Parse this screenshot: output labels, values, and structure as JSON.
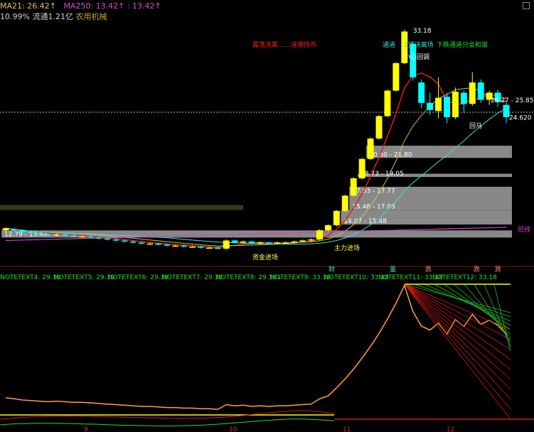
{
  "header": {
    "ma21_label": "MA21: 26.42↑",
    "ma250_label": "MA250: 13.42↑",
    "ma250_value": ": 13.42↑",
    "turnover": "10.99%",
    "float_cap": "流通1.21亿",
    "sector": "农用机械"
  },
  "colors": {
    "up": "#ffff00",
    "down": "#00ffff",
    "ma_red": "#e02020",
    "ma_olive": "#c8c050",
    "ma_magenta": "#d040d0",
    "ma_cyan": "#40e0d0",
    "note_green": "#20e020",
    "gap_gray": "#a0a0a0"
  },
  "chart_data": {
    "type": "candlestick",
    "x_ticks": [
      "9",
      "10",
      "11",
      "12"
    ],
    "price_labels": {
      "high": "33.18",
      "current": "24.620",
      "range_top": "26.27 - 25.85"
    },
    "gap_zones": [
      {
        "label": "20.60 - 21.80",
        "low": 20.6,
        "high": 21.8
      },
      {
        "label": "18.73 - 19.05",
        "low": 18.73,
        "high": 19.05
      },
      {
        "label": "17.03 - 17.77",
        "low": 17.03,
        "high": 17.77
      },
      {
        "label": "15.48 - 17.03",
        "low": 15.48,
        "high": 17.03
      },
      {
        "label": "14.07 - 15.48",
        "low": 14.07,
        "high": 15.48
      },
      {
        "label": "12.79 - 13.49",
        "low": 12.79,
        "high": 13.49
      }
    ],
    "annotations": {
      "wash": "震荡洗筹……道德持币",
      "tongdao_top": "通道",
      "tongdao_top_tail": "2坚决离场",
      "careful": "小心回调",
      "down_tongdao": "下跌通道只会和谐",
      "main_in": "资金进场",
      "main_in2": "主力进场",
      "pullback": "回马",
      "low_line": "低线",
      "huima": "回马"
    },
    "candles": [
      {
        "o": 13.5,
        "c": 13.7,
        "h": 13.8,
        "l": 13.4
      },
      {
        "o": 13.6,
        "c": 13.5,
        "h": 13.7,
        "l": 13.4
      },
      {
        "o": 13.5,
        "c": 13.3,
        "h": 13.6,
        "l": 13.2
      },
      {
        "o": 13.3,
        "c": 13.2,
        "h": 13.4,
        "l": 13.1
      },
      {
        "o": 13.2,
        "c": 13.1,
        "h": 13.3,
        "l": 13.0
      },
      {
        "o": 13.1,
        "c": 13.0,
        "h": 13.2,
        "l": 12.9
      },
      {
        "o": 13.0,
        "c": 13.1,
        "h": 13.2,
        "l": 12.9
      },
      {
        "o": 13.1,
        "c": 13.0,
        "h": 13.2,
        "l": 12.9
      },
      {
        "o": 13.0,
        "c": 12.9,
        "h": 13.1,
        "l": 12.8
      },
      {
        "o": 12.9,
        "c": 12.9,
        "h": 13.0,
        "l": 12.8
      },
      {
        "o": 12.9,
        "c": 12.8,
        "h": 13.0,
        "l": 12.7
      },
      {
        "o": 12.8,
        "c": 12.7,
        "h": 12.9,
        "l": 12.6
      },
      {
        "o": 12.7,
        "c": 12.6,
        "h": 12.8,
        "l": 12.5
      },
      {
        "o": 12.6,
        "c": 12.5,
        "h": 12.7,
        "l": 12.4
      },
      {
        "o": 12.5,
        "c": 12.4,
        "h": 12.6,
        "l": 12.3
      },
      {
        "o": 12.4,
        "c": 12.3,
        "h": 12.5,
        "l": 12.2
      },
      {
        "o": 12.3,
        "c": 12.2,
        "h": 12.4,
        "l": 12.1
      },
      {
        "o": 12.2,
        "c": 12.2,
        "h": 12.3,
        "l": 12.1
      },
      {
        "o": 12.2,
        "c": 12.1,
        "h": 12.3,
        "l": 12.0
      },
      {
        "o": 12.1,
        "c": 12.0,
        "h": 12.2,
        "l": 11.9
      },
      {
        "o": 12.0,
        "c": 12.0,
        "h": 12.1,
        "l": 11.9
      },
      {
        "o": 12.0,
        "c": 11.9,
        "h": 12.1,
        "l": 11.8
      },
      {
        "o": 11.9,
        "c": 11.9,
        "h": 12.0,
        "l": 11.8
      },
      {
        "o": 11.9,
        "c": 11.8,
        "h": 12.0,
        "l": 11.7
      },
      {
        "o": 11.8,
        "c": 11.8,
        "h": 11.9,
        "l": 11.7
      },
      {
        "o": 11.8,
        "c": 11.7,
        "h": 11.9,
        "l": 11.6
      },
      {
        "o": 11.7,
        "c": 12.5,
        "h": 12.6,
        "l": 11.6
      },
      {
        "o": 12.5,
        "c": 12.3,
        "h": 12.6,
        "l": 12.2
      },
      {
        "o": 12.3,
        "c": 12.4,
        "h": 12.5,
        "l": 12.2
      },
      {
        "o": 12.4,
        "c": 12.2,
        "h": 12.5,
        "l": 12.1
      },
      {
        "o": 12.2,
        "c": 12.3,
        "h": 12.4,
        "l": 12.1
      },
      {
        "o": 12.3,
        "c": 12.2,
        "h": 12.4,
        "l": 12.1
      },
      {
        "o": 12.2,
        "c": 12.3,
        "h": 12.4,
        "l": 12.1
      },
      {
        "o": 12.3,
        "c": 12.3,
        "h": 12.4,
        "l": 12.2
      },
      {
        "o": 12.3,
        "c": 12.4,
        "h": 12.5,
        "l": 12.2
      },
      {
        "o": 12.4,
        "c": 12.5,
        "h": 12.6,
        "l": 12.3
      },
      {
        "o": 12.5,
        "c": 12.6,
        "h": 12.7,
        "l": 12.4
      },
      {
        "o": 12.6,
        "c": 13.5,
        "h": 13.6,
        "l": 12.5
      },
      {
        "o": 13.5,
        "c": 14.0,
        "h": 14.1,
        "l": 13.4
      },
      {
        "o": 14.0,
        "c": 15.4,
        "h": 15.5,
        "l": 13.9
      },
      {
        "o": 15.4,
        "c": 16.9,
        "h": 17.0,
        "l": 15.3
      },
      {
        "o": 16.9,
        "c": 18.6,
        "h": 18.7,
        "l": 16.8
      },
      {
        "o": 18.6,
        "c": 20.5,
        "h": 20.6,
        "l": 18.5
      },
      {
        "o": 20.5,
        "c": 22.5,
        "h": 22.6,
        "l": 20.4
      },
      {
        "o": 22.5,
        "c": 24.7,
        "h": 24.8,
        "l": 22.4
      },
      {
        "o": 24.7,
        "c": 27.2,
        "h": 27.3,
        "l": 24.6
      },
      {
        "o": 27.2,
        "c": 29.9,
        "h": 30.0,
        "l": 27.1
      },
      {
        "o": 29.9,
        "c": 33.0,
        "h": 33.18,
        "l": 29.8
      },
      {
        "o": 31.8,
        "c": 28.5,
        "h": 32.0,
        "l": 28.2
      },
      {
        "o": 28.0,
        "c": 26.0,
        "h": 28.3,
        "l": 25.5
      },
      {
        "o": 26.0,
        "c": 25.3,
        "h": 27.0,
        "l": 24.8
      },
      {
        "o": 25.2,
        "c": 26.5,
        "h": 28.5,
        "l": 24.5
      },
      {
        "o": 26.6,
        "c": 24.6,
        "h": 27.0,
        "l": 24.0
      },
      {
        "o": 24.6,
        "c": 27.1,
        "h": 27.5,
        "l": 24.4
      },
      {
        "o": 27.0,
        "c": 25.9,
        "h": 27.2,
        "l": 25.0
      },
      {
        "o": 25.9,
        "c": 28.0,
        "h": 29.0,
        "l": 25.7
      },
      {
        "o": 28.0,
        "c": 26.3,
        "h": 28.3,
        "l": 26.0
      },
      {
        "o": 26.3,
        "c": 27.0,
        "h": 27.2,
        "l": 25.8
      },
      {
        "o": 27.0,
        "c": 26.1,
        "h": 27.3,
        "l": 25.6
      },
      {
        "o": 25.8,
        "c": 24.6,
        "h": 26.0,
        "l": 24.0
      }
    ],
    "notes": [
      {
        "label": "NOTETEXT4: 29.19"
      },
      {
        "label": "NOTETEXT5: 29.19"
      },
      {
        "label": "NOTETEXT6: 29.19"
      },
      {
        "label": "NOTETEXT7: 29.19"
      },
      {
        "label": "NOTETEXT8: 29.19↓"
      },
      {
        "label": "NOTETEXT9: 33.18"
      },
      {
        "label": "NOTETEXT10: 33.18"
      },
      {
        "label": "NOTETEXT11: 33.18"
      },
      {
        "label": "NOTETEXT12: 33.18"
      }
    ],
    "lower_markers": [
      "财",
      "量",
      "跌",
      "跌",
      "跌"
    ],
    "lower_max": 33.18
  }
}
